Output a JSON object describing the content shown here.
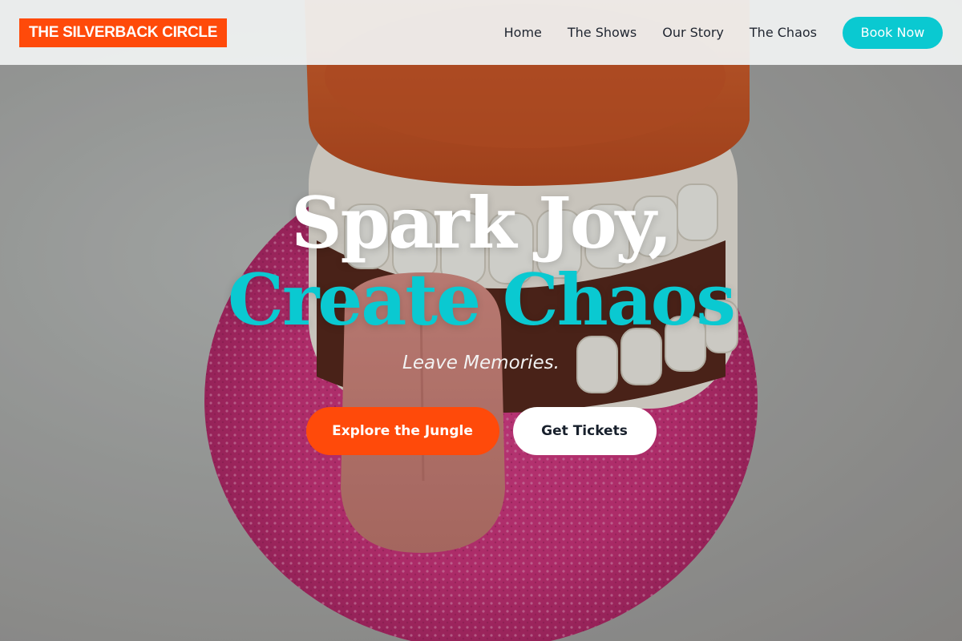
{
  "brand": {
    "name": "THE SILVERBACK CIRCLE"
  },
  "nav": {
    "items": [
      {
        "label": "Home"
      },
      {
        "label": "The Shows"
      },
      {
        "label": "Our Story"
      },
      {
        "label": "The Chaos"
      }
    ],
    "cta_label": "Book Now"
  },
  "hero": {
    "headline_line1": "Spark Joy,",
    "headline_line2": "Create Chaos",
    "tagline": "Leave Memories.",
    "primary_cta": "Explore the Jungle",
    "secondary_cta": "Get Tickets",
    "image_subject": "wind-up chattering teeth toy with tongue on pink textured surface"
  },
  "colors": {
    "brand_orange": "#ff4a0a",
    "accent_teal": "#0ac9d1",
    "white": "#ffffff",
    "nav_text": "#1f2530"
  }
}
